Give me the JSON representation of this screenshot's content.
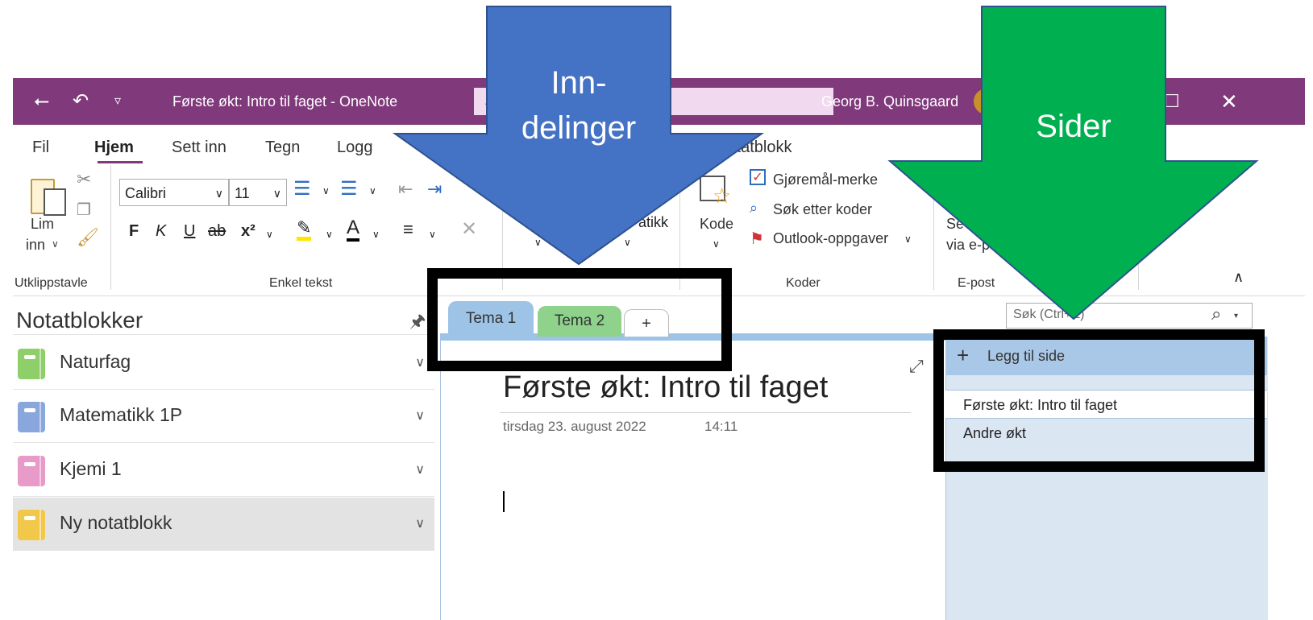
{
  "window": {
    "title": "Første økt: Intro til faget  -  OneNote",
    "user": "Georg B. Quinsgaard"
  },
  "ribbon": {
    "tabs": [
      "Fil",
      "Hjem",
      "Sett inn",
      "Tegn",
      "Logg",
      "Notatblokk"
    ],
    "clipboard": {
      "paste_label": "Lim",
      "paste_label2": "inn",
      "group": "Utklippstavle"
    },
    "basic_text": {
      "font": "Calibri",
      "size": "11",
      "bold": "F",
      "italic": "K",
      "underline": "U",
      "strike": "ab",
      "super": "x²",
      "group": "Enkel tekst"
    },
    "styles_partial": "atikk",
    "tags": {
      "kode_label": "Kode",
      "todo": "Gjøremål-merke",
      "find_tags": "Søk etter koder",
      "outlook": "Outlook-oppgaver",
      "group": "Koder"
    },
    "email": {
      "line1": "Se",
      "line2": "via e-p",
      "group": "E-post"
    }
  },
  "notebooks": {
    "header": "Notatblokker",
    "items": [
      {
        "label": "Naturfag",
        "color": "#8fcf6a"
      },
      {
        "label": "Matematikk 1P",
        "color": "#8aa7dd"
      },
      {
        "label": "Kjemi 1",
        "color": "#e89ac9"
      },
      {
        "label": "Ny notatblokk",
        "color": "#f2c84b"
      }
    ]
  },
  "sections": {
    "tabs": [
      {
        "label": "Tema 1",
        "color": "#9dc3e6"
      },
      {
        "label": "Tema 2",
        "color": "#8fd28c"
      }
    ],
    "add_label": "+"
  },
  "page": {
    "title": "Første økt: Intro til faget",
    "date": "tirsdag 23. august 2022",
    "time": "14:11"
  },
  "search": {
    "placeholder": "Søk (Ctrl+E)"
  },
  "pages": {
    "add_label": "Legg til side",
    "items": [
      "Første økt: Intro til faget",
      "Andre økt"
    ]
  },
  "annotations": {
    "blue_arrow_line1": "Inn-",
    "blue_arrow_line2": "delinger",
    "green_arrow": "Sider",
    "blue_color": "#4472c4",
    "green_color": "#00b050"
  }
}
